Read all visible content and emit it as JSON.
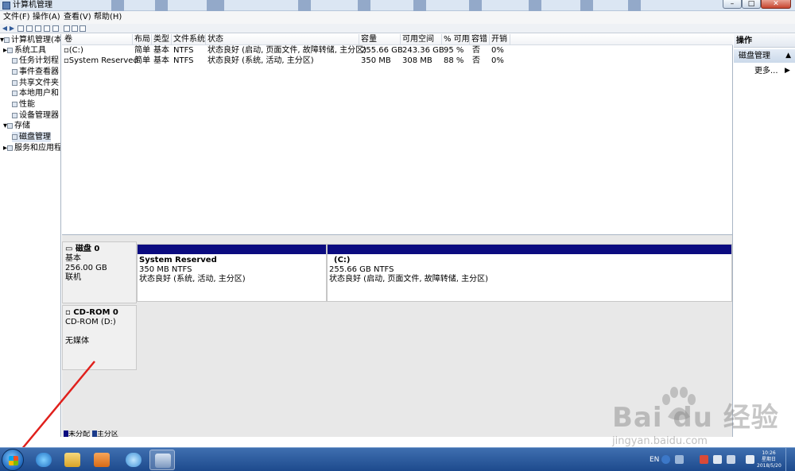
{
  "window": {
    "title": "计算机管理",
    "buttons": {
      "minimize": "–",
      "maximize": "□",
      "close": "✕"
    }
  },
  "menu": [
    "文件(F)",
    "操作(A)",
    "查看(V)",
    "帮助(H)"
  ],
  "tree": {
    "items": [
      {
        "label": "计算机管理(本地",
        "level": 0,
        "expander": "▾"
      },
      {
        "label": "系统工具",
        "level": 1,
        "expander": "▸"
      },
      {
        "label": "任务计划程",
        "level": 2
      },
      {
        "label": "事件查看器",
        "level": 2
      },
      {
        "label": "共享文件夹",
        "level": 2
      },
      {
        "label": "本地用户和",
        "level": 2
      },
      {
        "label": "性能",
        "level": 2
      },
      {
        "label": "设备管理器",
        "level": 2
      },
      {
        "label": "存储",
        "level": 1,
        "expander": "▾"
      },
      {
        "label": "磁盘管理",
        "level": 2,
        "selected": true
      },
      {
        "label": "服务和应用程",
        "level": 1,
        "expander": "▸"
      }
    ]
  },
  "volumes": {
    "columns": [
      "卷",
      "布局",
      "类型",
      "文件系统",
      "状态",
      "容量",
      "可用空间",
      "% 可用",
      "容错",
      "开销"
    ],
    "rows": [
      [
        "(C:)",
        "简单",
        "基本",
        "NTFS",
        "状态良好 (启动, 页面文件, 故障转储, 主分区)",
        "255.66 GB",
        "243.36 GB",
        "95 %",
        "否",
        "0%"
      ],
      [
        "System Reserved",
        "简单",
        "基本",
        "NTFS",
        "状态良好 (系统, 活动, 主分区)",
        "350 MB",
        "308 MB",
        "88 %",
        "否",
        "0%"
      ]
    ]
  },
  "disks": [
    {
      "name": "磁盘 0",
      "type": "基本",
      "size": "256.00 GB",
      "state": "联机",
      "partitions": [
        {
          "title": "System Reserved",
          "size_fs": "350 MB NTFS",
          "status": "状态良好 (系统, 活动, 主分区)"
        },
        {
          "title": "(C:)",
          "size_fs": "255.66 GB NTFS",
          "status": "状态良好 (启动, 页面文件, 故障转储, 主分区)"
        }
      ]
    },
    {
      "name": "CD-ROM 0",
      "type": "CD-ROM (D:)",
      "state": "无媒体"
    }
  ],
  "legend": [
    "未分配",
    "主分区"
  ],
  "actions": {
    "title": "操作",
    "section": "磁盘管理",
    "more": "更多..."
  },
  "taskbar": {
    "lang": "EN",
    "clock_time": "10:26",
    "clock_day": "星期日",
    "clock_date": "2018/5/20"
  },
  "watermark": {
    "brand": "Bai du 经验",
    "url": "jingyan.baidu.com"
  },
  "colors": {
    "partition_bar": "#0b0b80",
    "annotation_arrow": "#e0201c",
    "taskbar": "#1d4a8d"
  }
}
